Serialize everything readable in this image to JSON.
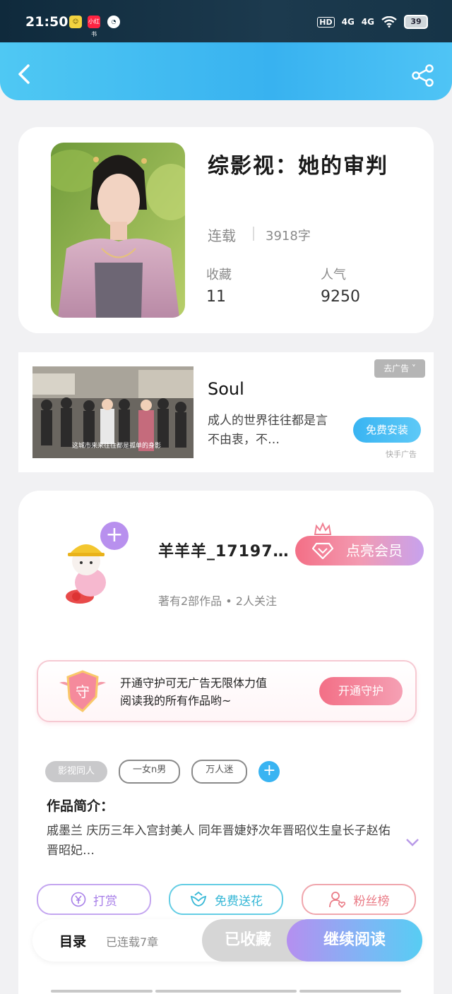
{
  "status_bar": {
    "time": "21:50",
    "network": [
      "4G",
      "4G"
    ],
    "battery": "39",
    "app_icon_2_label": "小红书"
  },
  "book": {
    "title": "综影视：她的审判",
    "status": "连载",
    "word_count": "3918字",
    "stats": [
      {
        "label": "收藏",
        "value": "11"
      },
      {
        "label": "人气",
        "value": "9250"
      }
    ]
  },
  "ad": {
    "title": "Soul",
    "description": "成人的世界往往都是言不由衷，不…",
    "image_caption": "这城市来来往往都是孤单的身影",
    "remove_label": "去广告",
    "install_label": "免费安装",
    "source": "快手广告"
  },
  "author": {
    "name": "羊羊羊_17197…",
    "meta": "著有2部作品 • 2人关注",
    "vip_label": "点亮会员",
    "follow_icon": "plus-icon"
  },
  "guard": {
    "badge_char": "守",
    "text_line1": "开通守护可无广告无限体力值",
    "text_line2": "阅读我的所有作品哟~",
    "button": "开通守护"
  },
  "tags": [
    "影视同人",
    "一女n男",
    "万人迷"
  ],
  "intro": {
    "title": "作品简介：",
    "body": "戚墨兰 庆历三年入宫封美人 同年晋婕妤次年晋昭仪生皇长子赵佑晋昭妃…"
  },
  "actions": {
    "reward": "打赏",
    "flower": "免费送花",
    "fans": "粉丝榜"
  },
  "bottom": {
    "toc": "目录",
    "chapters": "已连载7章",
    "collected": "已收藏",
    "read": "继续阅读"
  },
  "colors": {
    "header": "#38b2f0",
    "accent_purple": "#b890ee",
    "accent_pink": "#f36f86",
    "accent_blue": "#39b4f2"
  }
}
